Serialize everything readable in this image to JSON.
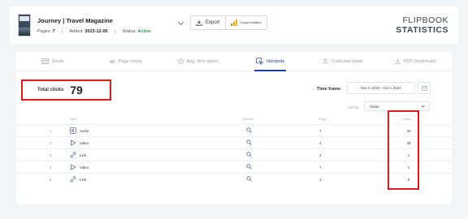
{
  "header": {
    "title": "Journey | Travel Magazine",
    "pages_label": "Pages:",
    "pages_value": "7",
    "added_label": "Added:",
    "added_value": "2023-12-05",
    "status_label": "Status:",
    "status_value": "Active",
    "export_label": "Export",
    "ga_label": "Google Analytics",
    "brand_line1": "FLIPBOOK",
    "brand_line2": "STATISTICS"
  },
  "tabs": [
    {
      "label": "Views",
      "icon": "views-icon"
    },
    {
      "label": "Page views",
      "icon": "eye-icon"
    },
    {
      "label": "Avg. time spent",
      "icon": "clock-icon"
    },
    {
      "label": "Hotspots",
      "icon": "hotspot-cursor-icon",
      "active": true
    },
    {
      "label": "Collected leads",
      "icon": "user-icon"
    },
    {
      "label": "PDF Downloads",
      "icon": "download-icon"
    }
  ],
  "total_clicks": {
    "label": "Total clicks",
    "value": "79"
  },
  "time_frame": {
    "label": "Time frame",
    "value": "Dec 5, 2023 - Oct 1, 2024"
  },
  "sort_by": {
    "label": "Sort by",
    "value": "Clicks"
  },
  "table": {
    "headers": {
      "type": "Type",
      "preview": "Preview",
      "page": "Page",
      "clicks": "Clicks"
    },
    "rows": [
      {
        "num": "1",
        "type": "Audio",
        "icon": "audio-icon",
        "page": "7",
        "clicks": "42"
      },
      {
        "num": "2",
        "type": "Video",
        "icon": "play-icon",
        "page": "4",
        "clicks": "35"
      },
      {
        "num": "3",
        "type": "Link",
        "icon": "link-icon",
        "page": "2",
        "clicks": "1"
      },
      {
        "num": "4",
        "type": "Video",
        "icon": "play-icon",
        "page": "7",
        "clicks": "1"
      },
      {
        "num": "5",
        "type": "Link",
        "icon": "link-icon",
        "page": "1",
        "clicks": "0"
      }
    ]
  },
  "colors": {
    "accent": "#1f3fa8",
    "highlight": "#e01919",
    "status_active": "#2e9e4f",
    "background": "#f4f5f7"
  }
}
